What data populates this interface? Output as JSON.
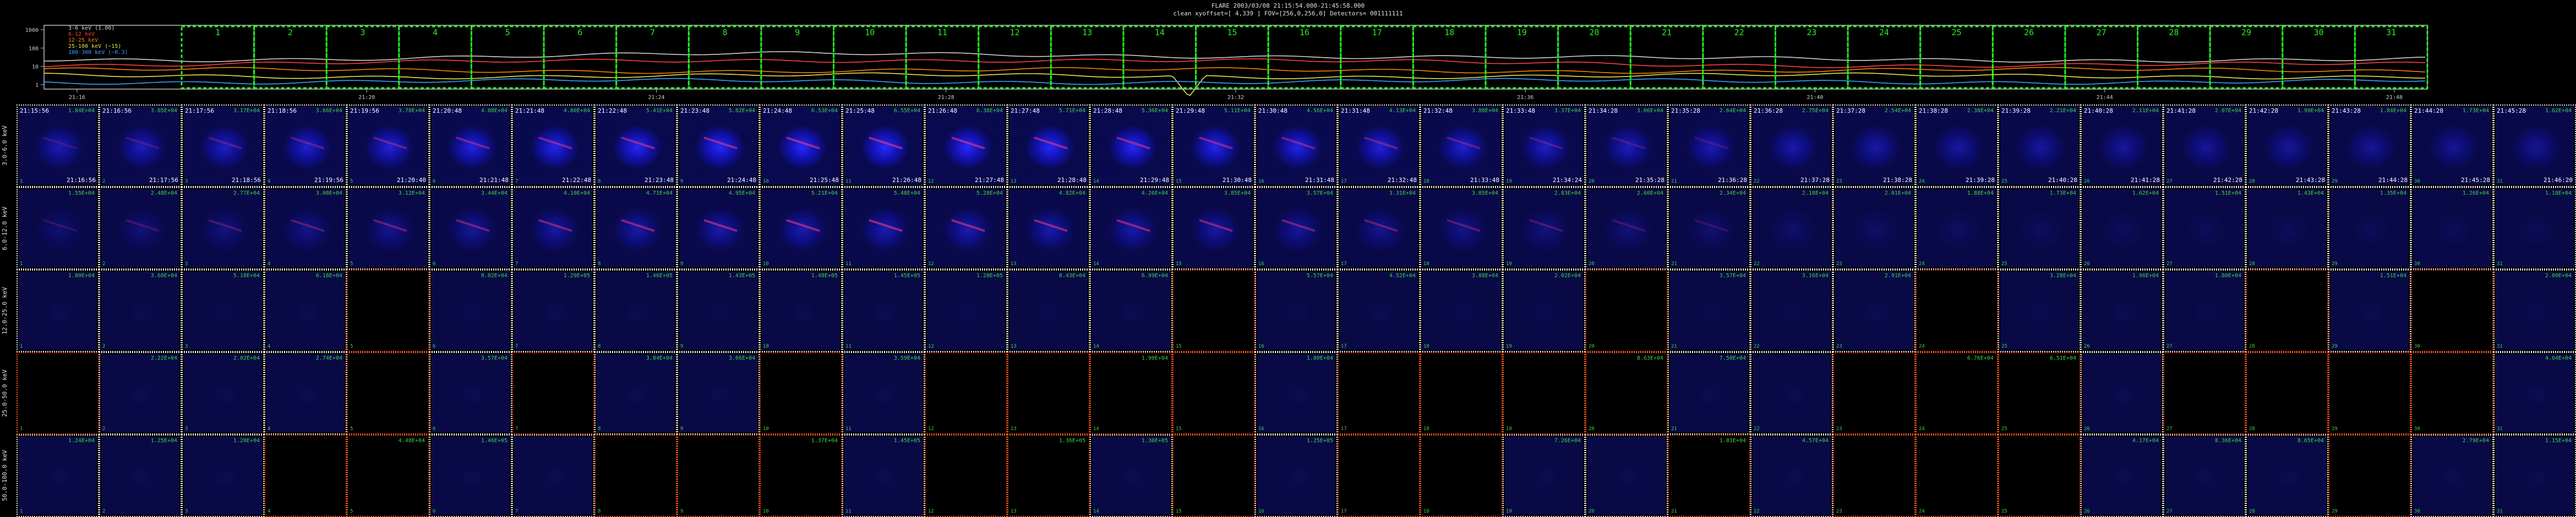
{
  "header": {
    "title": "FLARE 2003/03/08 21:15:54.000-21:45:58.000",
    "subtitle": "clean    xyoffset=[   4,339 ]    FOV=[256,0,256,0]    Detectors= 001111111"
  },
  "lightcurve": {
    "ytick_labels": [
      "1000",
      "100",
      "10",
      "1"
    ],
    "legend": [
      {
        "label": "3-6 keV (1.00)",
        "color": "#d0d0d0"
      },
      {
        "label": "6-12 keV",
        "color": "#ff4040"
      },
      {
        "label": "12-25 keV",
        "color": "#ff8000"
      },
      {
        "label": "25-100 keV (~15)",
        "color": "#e6e64c"
      },
      {
        "label": "100-300 keV (~0.3)",
        "color": "#3aa0ff"
      }
    ],
    "xtick_labels": [
      "21:16",
      "21:20",
      "21:24",
      "21:28",
      "21:32",
      "21:36",
      "21:40",
      "21:44",
      "21:48"
    ],
    "interval_numbers": [
      "1",
      "2",
      "3",
      "4",
      "5",
      "6",
      "7",
      "8",
      "9",
      "10",
      "11",
      "12",
      "13",
      "14",
      "15",
      "16",
      "17",
      "18",
      "19",
      "20",
      "21",
      "22",
      "23",
      "24",
      "25",
      "26",
      "27",
      "28",
      "29",
      "30",
      "31"
    ],
    "interval_color": "#22ee22"
  },
  "energy_bands": [
    "3.0-6.0 keV",
    "6.0-12.0 keV",
    "12.0-25.0 keV",
    "25.0-50.0 keV",
    "50.0-100.0 keV"
  ],
  "start_times": [
    "21:15:56",
    "21:16:56",
    "21:17:56",
    "21:18:56",
    "21:19:56",
    "21:20:48",
    "21:21:48",
    "21:22:48",
    "21:23:48",
    "21:24:48",
    "21:25:48",
    "21:26:48",
    "21:27:48",
    "21:28:48",
    "21:29:48",
    "21:30:48",
    "21:31:48",
    "21:32:48",
    "21:33:48",
    "21:34:28",
    "21:35:28",
    "21:36:28",
    "21:37:28",
    "21:38:28",
    "21:39:28",
    "21:40:28",
    "21:41:28",
    "21:42:28",
    "21:43:28",
    "21:44:28",
    "21:45:28"
  ],
  "end_times": [
    "21:16:56",
    "21:17:56",
    "21:18:56",
    "21:19:56",
    "21:20:40",
    "21:21:48",
    "21:22:48",
    "21:23:48",
    "21:24:48",
    "21:25:48",
    "21:26:48",
    "21:27:48",
    "21:28:48",
    "21:29:48",
    "21:30:48",
    "21:31:48",
    "21:32:48",
    "21:33:48",
    "21:34:24",
    "21:35:28",
    "21:36:28",
    "21:37:28",
    "21:38:28",
    "21:39:28",
    "21:40:28",
    "21:41:28",
    "21:42:28",
    "21:43:28",
    "21:44:28",
    "21:45:28",
    "21:46:20"
  ],
  "row_values": [
    [
      "1.84E+04",
      "3.05E+04",
      "3.17E+04",
      "3.66E+04",
      "3.78E+04",
      "4.08E+04",
      "4.80E+04",
      "5.41E+04",
      "5.82E+04",
      "6.53E+04",
      "6.55E+04",
      "6.38E+04",
      "5.71E+04",
      "5.36E+04",
      "5.11E+04",
      "4.56E+04",
      "4.13E+04",
      "3.80E+04",
      "3.37E+04",
      "3.06E+04",
      "2.64E+04",
      "2.75E+04",
      "2.54E+04",
      "2.38E+04",
      "2.21E+04",
      "2.11E+04",
      "2.07E+04",
      "1.99E+04",
      "1.84E+04",
      "1.73E+04",
      "1.62E+04"
    ],
    [
      "1.55E+04",
      "2.48E+04",
      "2.77E+04",
      "3.08E+04",
      "3.12E+04",
      "3.44E+04",
      "4.10E+04",
      "4.71E+04",
      "4.95E+04",
      "5.21E+04",
      "5.48E+04",
      "5.28E+04",
      "4.82E+04",
      "4.26E+04",
      "3.85E+04",
      "3.57E+04",
      "3.31E+04",
      "3.05E+04",
      "2.83E+04",
      "2.60E+04",
      "2.34E+04",
      "2.18E+04",
      "2.01E+04",
      "1.88E+04",
      "1.73E+04",
      "1.62E+04",
      "1.51E+04",
      "1.43E+04",
      "1.35E+04",
      "1.26E+04",
      "1.18E+04"
    ],
    [
      "1.80E+04",
      "3.68E+04",
      "5.18E+04",
      "6.18E+04",
      "",
      "8.02E+04",
      "1.29E+05",
      "1.46E+05",
      "1.43E+05",
      "1.48E+05",
      "1.45E+05",
      "1.28E+05",
      "8.43E+04",
      "6.99E+04",
      "",
      "5.57E+04",
      "4.52E+04",
      "3.88E+04",
      "2.02E+04",
      "",
      "3.57E+04",
      "3.16E+04",
      "2.91E+04",
      "",
      "3.28E+04",
      "1.96E+04",
      "1.80E+04",
      "",
      "1.51E+04",
      "",
      "2.00E+04"
    ],
    [
      "",
      "2.22E+04",
      "2.02E+04",
      "2.74E+04",
      "",
      "3.57E+04",
      "",
      "3.84E+04",
      "3.66E+04",
      "",
      "3.59E+04",
      "",
      "",
      "1.90E+04",
      "",
      "1.80E+04",
      "",
      "",
      "",
      "8.63E+04",
      "7.50E+04",
      "",
      "",
      "6.76E+04",
      "6.51E+04",
      "",
      "",
      "",
      "",
      "",
      "4.64E+04"
    ],
    [
      "1.24E+04",
      "1.25E+04",
      "1.20E+04",
      "",
      "4.48E+04",
      "1.46E+05",
      "",
      "",
      "",
      "1.37E+04",
      "1.45E+05",
      "",
      "1.36E+05",
      "1.30E+05",
      "",
      "1.25E+05",
      "",
      "",
      "7.26E+04",
      "",
      "1.01E+04",
      "4.57E+04",
      "",
      "",
      "",
      "4.17E+04",
      "8.36E+04",
      "8.65E+04",
      "",
      "2.79E+04",
      "1.15E+04"
    ]
  ],
  "missing_map": [
    "0000000000000000000000000000000",
    "0000000000000000000000000000000",
    "0000100000000010000100010001010",
    "1000101001011110111100111011110",
    "0001100111011010110010111000100"
  ],
  "colors": {
    "image_blue": "#1c1cff",
    "panel_border": "#e6e6e6",
    "panel_border_bad": "#ff5a1a",
    "value_text": "#3bd43b"
  }
}
